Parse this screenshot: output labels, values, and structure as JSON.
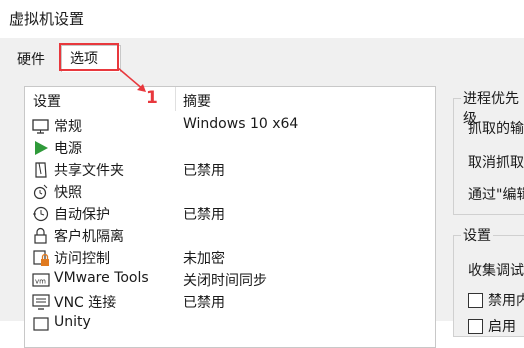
{
  "window": {
    "title": "虚拟机设置"
  },
  "tabs": [
    {
      "label": "硬件"
    },
    {
      "label": "选项"
    }
  ],
  "annotation": {
    "number": "1",
    "color": "#e8383d"
  },
  "list": {
    "columns": {
      "setting": "设置",
      "summary": "摘要"
    },
    "rows": [
      {
        "name": "常规",
        "summary": "Windows 10 x64",
        "icon": "monitor-icon"
      },
      {
        "name": "电源",
        "summary": "",
        "icon": "play-icon"
      },
      {
        "name": "共享文件夹",
        "summary": "已禁用",
        "icon": "shared-folder-icon"
      },
      {
        "name": "快照",
        "summary": "",
        "icon": "snapshot-icon"
      },
      {
        "name": "自动保护",
        "summary": "已禁用",
        "icon": "autoprotect-clock-icon"
      },
      {
        "name": "客户机隔离",
        "summary": "",
        "icon": "lock-icon"
      },
      {
        "name": "访问控制",
        "summary": "未加密",
        "icon": "access-control-lock-icon"
      },
      {
        "name": "VMware Tools",
        "summary": "关闭时间同步",
        "icon": "vm-icon"
      },
      {
        "name": "VNC 连接",
        "summary": "已禁用",
        "icon": "vnc-icon"
      },
      {
        "name": "Unity",
        "summary": "",
        "icon": "unity-icon"
      }
    ]
  },
  "process_group": {
    "title": "进程优先级",
    "items": [
      "抓取的输",
      "取消抓取",
      "通过\"编辑"
    ]
  },
  "settings_group": {
    "title": "设置",
    "items": [
      "收集调试"
    ],
    "checkboxes": [
      {
        "label": "禁用内",
        "checked": false
      },
      {
        "label": "启用",
        "checked": false
      }
    ]
  }
}
